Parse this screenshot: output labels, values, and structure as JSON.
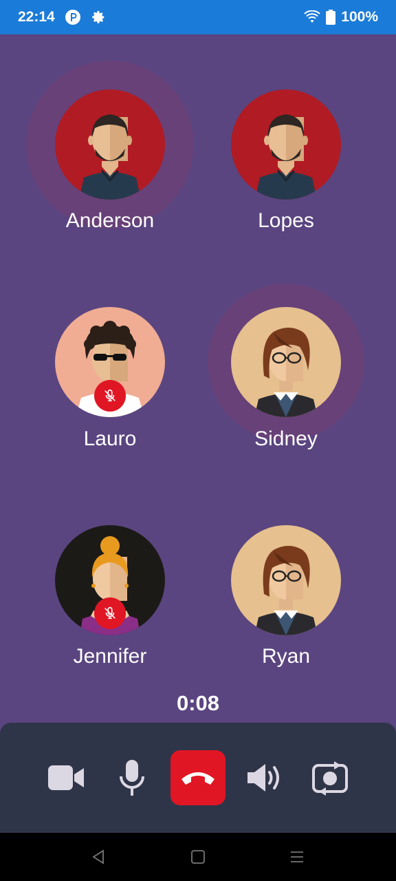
{
  "status_bar": {
    "time": "22:14",
    "battery": "100%",
    "icons": [
      "pinned-app-icon",
      "settings-gear-icon",
      "wifi-icon",
      "battery-icon"
    ]
  },
  "participants": [
    {
      "name": "Anderson",
      "muted": false,
      "speaking": true,
      "avatar": "bearded-man-avatar",
      "avatar_bg": "#b11b24"
    },
    {
      "name": "Lopes",
      "muted": false,
      "speaking": false,
      "avatar": "bearded-man-avatar",
      "avatar_bg": "#b11b24"
    },
    {
      "name": "Lauro",
      "muted": true,
      "speaking": false,
      "avatar": "curly-hair-sunglasses-avatar",
      "avatar_bg": "#f0ad94"
    },
    {
      "name": "Sidney",
      "muted": false,
      "speaking": true,
      "avatar": "glasses-brown-hair-avatar",
      "avatar_bg": "#e6c08e"
    },
    {
      "name": "Jennifer",
      "muted": true,
      "speaking": false,
      "avatar": "blonde-bun-woman-avatar",
      "avatar_bg": "#1c1a17"
    },
    {
      "name": "Ryan",
      "muted": false,
      "speaking": false,
      "avatar": "glasses-brown-hair-avatar",
      "avatar_bg": "#e6c08e"
    }
  ],
  "call": {
    "duration": "0:08"
  },
  "controls": [
    {
      "name": "video-camera-button",
      "icon": "video-camera-icon"
    },
    {
      "name": "microphone-button",
      "icon": "microphone-icon"
    },
    {
      "name": "end-call-button",
      "icon": "hang-up-phone-icon"
    },
    {
      "name": "speaker-button",
      "icon": "speaker-volume-icon"
    },
    {
      "name": "switch-camera-button",
      "icon": "switch-camera-icon"
    }
  ],
  "colors": {
    "status_bar": "#1b7bd8",
    "background": "#5a4580",
    "control_panel": "#2f3549",
    "end_call": "#e01625",
    "muted_badge": "#e01625"
  },
  "nav_bar": {
    "buttons": [
      "back-icon",
      "home-icon",
      "recents-menu-icon"
    ]
  }
}
